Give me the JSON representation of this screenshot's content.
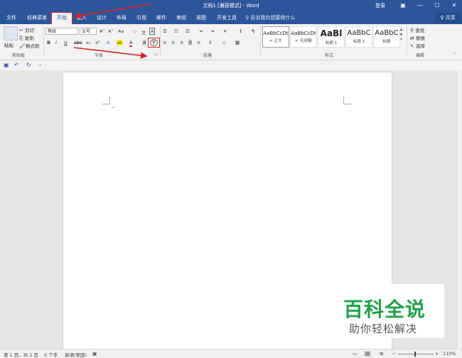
{
  "window": {
    "title": "文档1 [兼容模式] - Word",
    "login": "登录",
    "controls": {
      "ribbon_options": "▣",
      "minimize": "—",
      "maximize": "☐",
      "close": "✕"
    }
  },
  "tabs": [
    {
      "label": "文件"
    },
    {
      "label": "经典菜单"
    },
    {
      "label": "开始",
      "active": true
    },
    {
      "label": "插入"
    },
    {
      "label": "设计"
    },
    {
      "label": "布局"
    },
    {
      "label": "引用"
    },
    {
      "label": "邮件"
    },
    {
      "label": "审阅"
    },
    {
      "label": "视图"
    },
    {
      "label": "开发工具"
    }
  ],
  "tellme": "♀ 告诉我你想要做什么",
  "share": "♀ 共享",
  "ribbon": {
    "clipboard": {
      "paste": "粘贴",
      "cut": "剪切",
      "copy": "复制",
      "format_painter": "格式刷",
      "label": "剪贴板"
    },
    "font": {
      "name": "等线",
      "size": "五号",
      "grow": "A˄",
      "shrink": "A˅",
      "case": "Aa",
      "clear": "◇",
      "wen": "文",
      "border": "A",
      "bold": "B",
      "italic": "I",
      "underline": "U",
      "strike": "abc",
      "sub": "x₂",
      "sup": "x²",
      "effects": "A",
      "highlight": "ab",
      "color": "A",
      "shade": "A",
      "enclose": "字",
      "label": "字体"
    },
    "paragraph": {
      "row1": [
        "☰",
        "☷",
        "☰",
        "⇤",
        "⇥",
        "✕",
        "↕",
        "¶"
      ],
      "row2": [
        "≡",
        "≡",
        "≡",
        "≡",
        "≡",
        "⇕",
        "◇",
        "▦"
      ],
      "label": "段落"
    },
    "styles": {
      "items": [
        {
          "sample": "AaBbCcDt",
          "name": "↵ 正文",
          "selected": true
        },
        {
          "sample": "AaBbCcDt",
          "name": "↵ 无间隔"
        },
        {
          "sample": "AaBl",
          "name": "标题 1"
        },
        {
          "sample": "AaBbC",
          "name": "标题 2"
        },
        {
          "sample": "AaBbC",
          "name": "标题"
        }
      ],
      "label": "样式"
    },
    "editing": {
      "find": "查找",
      "replace": "替换",
      "select": "选择",
      "label": "编辑"
    }
  },
  "qat": {
    "save": "▣",
    "undo": "↶",
    "redo": "↻",
    "more": "⌄"
  },
  "document": {
    "cursor_mark": "↵"
  },
  "status": {
    "page": "第 1 页，共 1 页",
    "words": "0 个字",
    "lang": "英语(美国)",
    "macro": "▣",
    "zoom": "110%"
  },
  "watermark": {
    "main": "百科全说",
    "sub": "助你轻松解决"
  },
  "colors": {
    "accent": "#2b579a",
    "annotation": "#e02020",
    "brand_green": "#21a34a"
  }
}
